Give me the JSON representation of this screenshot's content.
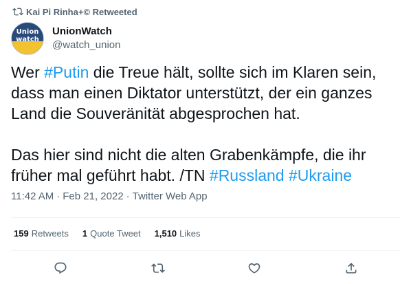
{
  "retweet_context": {
    "icon": "retweet-icon",
    "text": "Kai Pi Rinha+© Retweeted"
  },
  "author": {
    "avatar_text_line1": "Union",
    "avatar_text_line2": "watch",
    "display_name": "UnionWatch",
    "handle": "@watch_union"
  },
  "tweet": {
    "para1": [
      {
        "text": "Wer ",
        "hashtag": false
      },
      {
        "text": "#Putin",
        "hashtag": true
      },
      {
        "text": " die Treue hält, sollte sich im Klaren sein, dass man einen Diktator unterstützt, der ein ganzes Land die Souveränität abgesprochen hat.",
        "hashtag": false
      }
    ],
    "para2": [
      {
        "text": "Das hier sind nicht die alten Grabenkämpfe, die ihr früher mal geführt habt. /TN ",
        "hashtag": false
      },
      {
        "text": "#Russland",
        "hashtag": true
      },
      {
        "text": " ",
        "hashtag": false
      },
      {
        "text": "#Ukraine",
        "hashtag": true
      }
    ]
  },
  "meta": {
    "time": "11:42 AM",
    "date": "Feb 21, 2022",
    "source": "Twitter Web App",
    "separator": "·"
  },
  "stats": {
    "retweets_count": "159",
    "retweets_label": "Retweets",
    "quotes_count": "1",
    "quotes_label": "Quote Tweet",
    "likes_count": "1,510",
    "likes_label": "Likes"
  },
  "actions": {
    "reply_icon": "reply-icon",
    "retweet_icon": "retweet-icon",
    "like_icon": "like-icon",
    "share_icon": "share-icon"
  },
  "colors": {
    "text": "#0f1419",
    "secondary": "#536471",
    "hashtag": "#1d9bf0",
    "divider": "#eff3f4"
  }
}
